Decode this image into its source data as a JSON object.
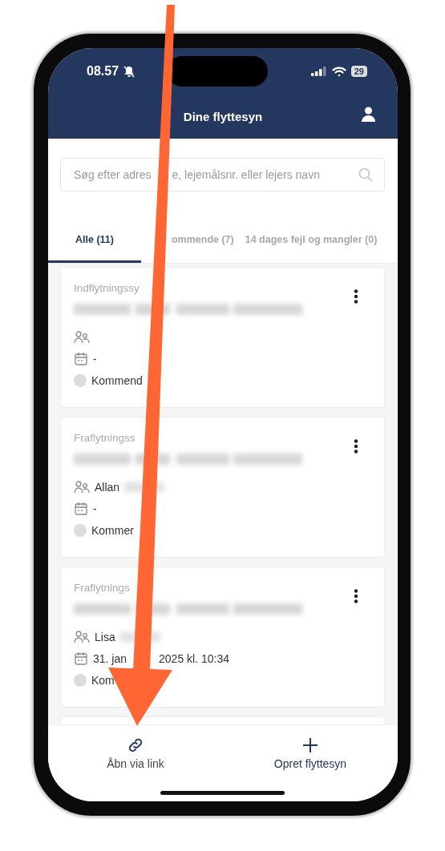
{
  "status_bar": {
    "time": "08.57",
    "battery": "29"
  },
  "header": {
    "title": "Dine flyttesyn"
  },
  "search": {
    "placeholder": [
      "Søg efter adres",
      "e, lejemålsnr. eller lejers navn"
    ]
  },
  "tabs": [
    {
      "label": "Alle (11)",
      "selected": true
    },
    {
      "label": "ommende (7)",
      "selected": false
    },
    {
      "label": "14 dages fejl og mangler (0)",
      "selected": false
    }
  ],
  "cards": [
    {
      "type": "Indflytningssy",
      "date": [
        "-"
      ],
      "status": "Kommend",
      "surname_blurred": false
    },
    {
      "type": "Fraflytningss",
      "person": "Allan",
      "date": [
        "-"
      ],
      "status": "Kommer",
      "surname_blurred": true
    },
    {
      "type": "Fraflytnings",
      "person": "Lisa",
      "date": [
        "31. jan",
        "2025 kl. 10:34"
      ],
      "status": "Kom",
      "surname_blurred": true
    }
  ],
  "bottom_nav": [
    {
      "kind": "link",
      "label": "Åbn via link"
    },
    {
      "kind": "add",
      "label": "Opret flyttesyn"
    }
  ]
}
